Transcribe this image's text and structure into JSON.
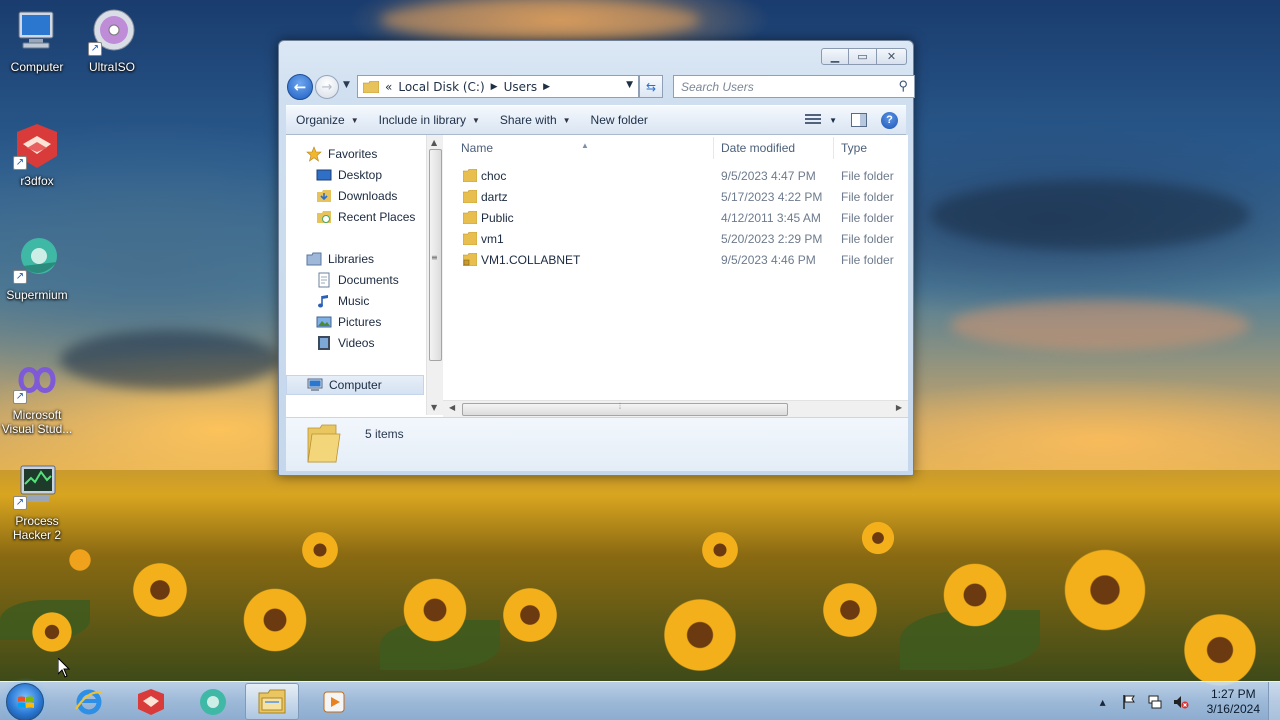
{
  "desktop": {
    "icons": [
      {
        "label": "Computer",
        "icon": "computer-icon"
      },
      {
        "label": "UltraISO",
        "icon": "disc-icon"
      },
      {
        "label": "r3dfox",
        "icon": "r3dfox-icon"
      },
      {
        "label": "Supermium",
        "icon": "supermium-icon"
      },
      {
        "label_line1": "Microsoft",
        "label_line2": "Visual Stud...",
        "icon": "visual-studio-icon"
      },
      {
        "label_line1": "Process",
        "label_line2": "Hacker 2",
        "icon": "process-hacker-icon"
      }
    ]
  },
  "explorer": {
    "address": {
      "overflow": "«",
      "segments": [
        "Local Disk (C:)",
        "Users"
      ]
    },
    "search_placeholder": "Search Users",
    "toolbar": {
      "organize": "Organize",
      "include_in_library": "Include in library",
      "share_with": "Share with",
      "new_folder": "New folder"
    },
    "nav": {
      "favorites": "Favorites",
      "desktop": "Desktop",
      "downloads": "Downloads",
      "recent_places": "Recent Places",
      "libraries": "Libraries",
      "documents": "Documents",
      "music": "Music",
      "pictures": "Pictures",
      "videos": "Videos",
      "computer": "Computer"
    },
    "columns": {
      "name": "Name",
      "date_modified": "Date modified",
      "type": "Type"
    },
    "files": [
      {
        "name": "choc",
        "date": "9/5/2023 4:47 PM",
        "type": "File folder"
      },
      {
        "name": "dartz",
        "date": "5/17/2023 4:22 PM",
        "type": "File folder"
      },
      {
        "name": "Public",
        "date": "4/12/2011 3:45 AM",
        "type": "File folder"
      },
      {
        "name": "vm1",
        "date": "5/20/2023 2:29 PM",
        "type": "File folder"
      },
      {
        "name": "VM1.COLLABNET",
        "date": "9/5/2023 4:46 PM",
        "type": "File folder"
      }
    ],
    "status": "5 items"
  },
  "taskbar": {
    "time": "1:27 PM",
    "date": "3/16/2024"
  }
}
